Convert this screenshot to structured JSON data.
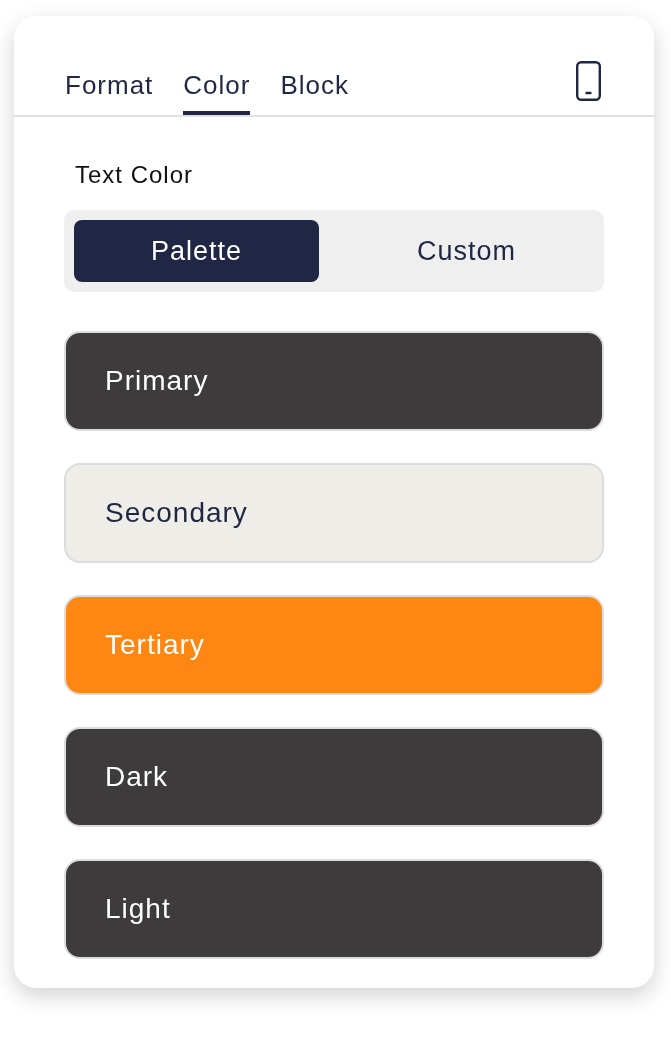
{
  "tabs": [
    {
      "label": "Format",
      "selected": false
    },
    {
      "label": "Color",
      "selected": true
    },
    {
      "label": "Block",
      "selected": false
    }
  ],
  "text_color": {
    "label": "Text Color",
    "modes": [
      {
        "label": "Palette",
        "selected": true
      },
      {
        "label": "Custom",
        "selected": false
      }
    ],
    "swatches": [
      {
        "label": "Primary",
        "color": "#3d3b3c"
      },
      {
        "label": "Secondary",
        "color": "#efede8"
      },
      {
        "label": "Tertiary",
        "color": "#fd8712"
      },
      {
        "label": "Dark",
        "color": "#3d3b3c"
      },
      {
        "label": "Light",
        "color": "#3d3b3c"
      }
    ]
  }
}
